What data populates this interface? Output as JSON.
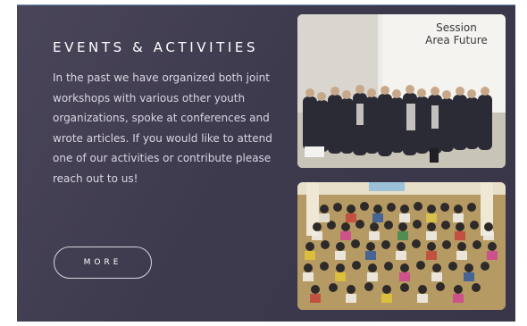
{
  "section": {
    "heading": "EVENTS & ACTIVITIES",
    "body": "In the past we have organized both joint workshops with various other youth organizations, spoke at conferences and wrote articles. If you would like to attend one of our activities or contribute please reach out to us!",
    "more_label": "MORE"
  },
  "photos": [
    {
      "sign_line1": "Session",
      "sign_line2": "Area Future"
    },
    {}
  ],
  "colors": {
    "panel": "#423e52",
    "text": "#d9d6e0",
    "accent_border": "#6d8fb5"
  }
}
